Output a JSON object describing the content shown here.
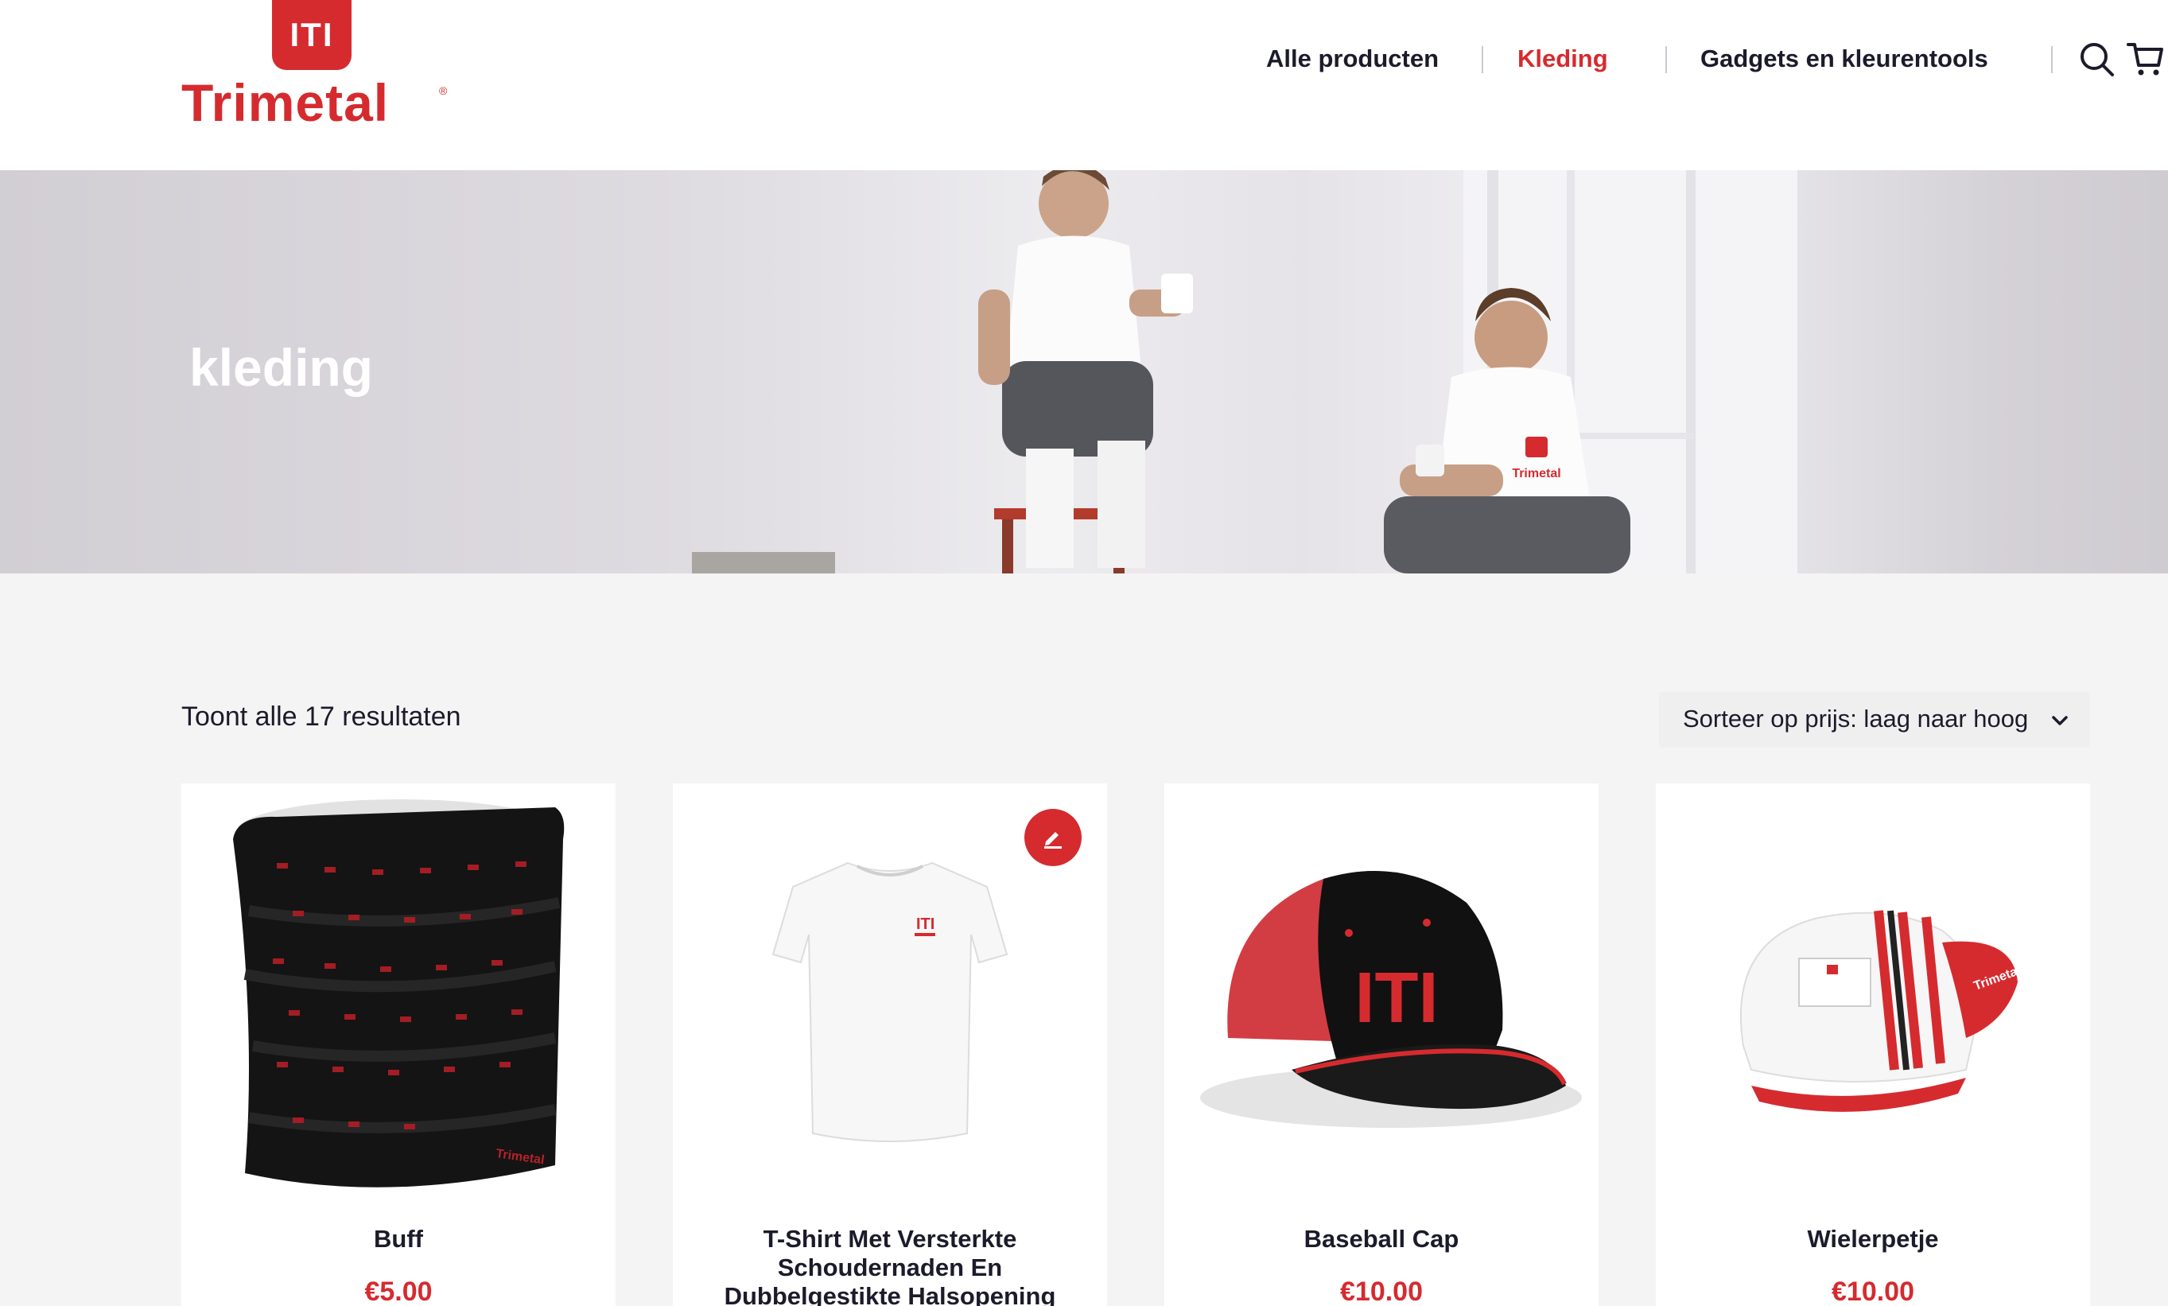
{
  "brand": {
    "badge": "ITI",
    "name": "Trimetal",
    "registered": "®"
  },
  "nav": {
    "items": [
      {
        "label": "Alle producten",
        "active": false
      },
      {
        "label": "Kleding",
        "active": true
      },
      {
        "label": "Gadgets en kleurentools",
        "active": false
      }
    ],
    "icons": [
      "search-icon",
      "cart-icon",
      "account-icon"
    ]
  },
  "hero": {
    "title": "kleding"
  },
  "toolbar": {
    "result_count": "Toont alle 17 resultaten",
    "sort_label": "Sorteer op prijs: laag naar hoog"
  },
  "products": [
    {
      "title": "Buff",
      "price": "€5.00"
    },
    {
      "title": "T-Shirt Met Versterkte Schoudernaden En Dubbelgestikte Halsopening",
      "price": ""
    },
    {
      "title": "Baseball Cap",
      "price": "€10.00"
    },
    {
      "title": "Wielerpetje",
      "price": "€10.00"
    }
  ],
  "product_image_text": {
    "cap_logo": "ITI",
    "shirt_logo": "ITI",
    "buff_brand": "Trimetal",
    "cycling_brand": "Trimetal",
    "hero_shirt_brand": "Trimetal"
  },
  "colors": {
    "accent": "#d52b2f",
    "text": "#1b1b2b",
    "background": "#f4f4f4"
  }
}
